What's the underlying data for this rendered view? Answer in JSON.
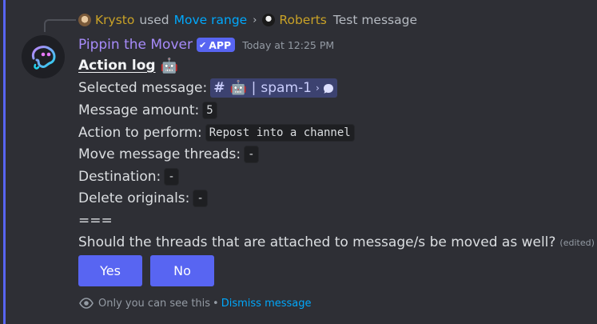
{
  "reply": {
    "user": "Krysto",
    "used": "used",
    "command": "Move range",
    "separator": "›",
    "target_user": "Roberts",
    "target_text": "Test message"
  },
  "message": {
    "author": "Pippin the Mover",
    "badge": "APP",
    "badge_check": "✔",
    "timestamp": "Today at 12:25 PM"
  },
  "content": {
    "heading": "Action log",
    "heading_emoji": "🤖",
    "selected_label": "Selected message:",
    "selected_channel": {
      "hash": "#",
      "emoji": "🤖",
      "pipe": "|",
      "name": "spam-1",
      "arrow": "›"
    },
    "amount_label": "Message amount:",
    "amount_value": "5",
    "action_label": "Action to perform:",
    "action_value": "Repost into a channel",
    "threads_label": "Move message threads:",
    "threads_value": "-",
    "destination_label": "Destination:",
    "destination_value": "-",
    "delete_label": "Delete originals:",
    "delete_value": "-",
    "divider": "===",
    "question": "Should the threads that are attached to message/s be moved as well?",
    "edited": "(edited)"
  },
  "buttons": {
    "yes": "Yes",
    "no": "No"
  },
  "ephemeral": {
    "text": "Only you can see this",
    "dot": "•",
    "dismiss": "Dismiss message"
  },
  "colors": {
    "accent": "#5865f2",
    "author": "#a78bfa",
    "reply_user": "#c9a227",
    "link": "#00a8fc"
  }
}
